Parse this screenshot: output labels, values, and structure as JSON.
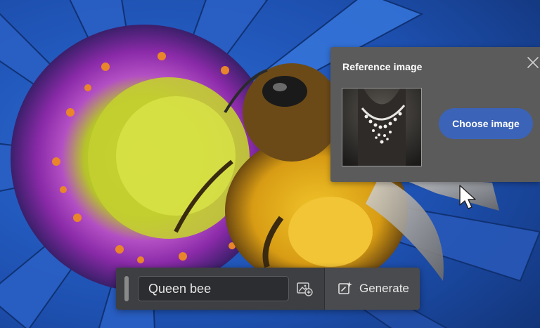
{
  "reference_panel": {
    "title": "Reference image",
    "choose_button_label": "Choose image",
    "thumbnail_icon": "necklace-photo"
  },
  "prompt_bar": {
    "input_value": "Queen bee",
    "add_image_icon": "image-add-icon",
    "generate_icon": "sparkle-generate-icon",
    "generate_label": "Generate"
  },
  "colors": {
    "panel_bg": "#5b5b5b",
    "accent_button": "#3b63b8",
    "toolbar_bg": "#3e3f42"
  }
}
